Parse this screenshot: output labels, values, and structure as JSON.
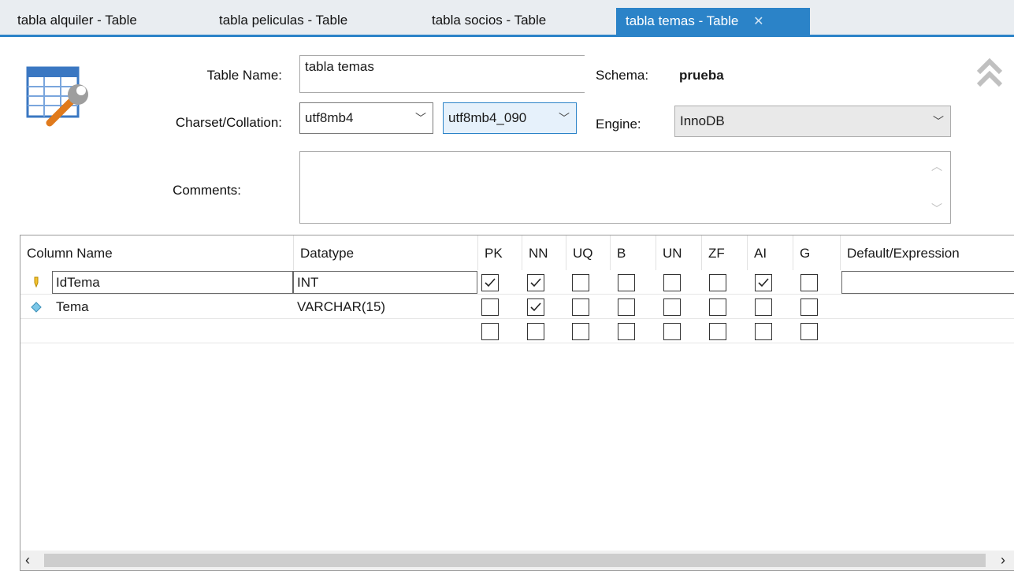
{
  "tabs": [
    {
      "label": "tabla alquiler - Table",
      "active": false
    },
    {
      "label": "tabla peliculas - Table",
      "active": false
    },
    {
      "label": "tabla socios - Table",
      "active": false
    },
    {
      "label": "tabla temas - Table",
      "active": true
    }
  ],
  "form": {
    "table_name_label": "Table Name:",
    "table_name_value": "tabla temas",
    "schema_label": "Schema:",
    "schema_value": "prueba",
    "charset_label": "Charset/Collation:",
    "charset_value": "utf8mb4",
    "collation_value": "utf8mb4_090",
    "engine_label": "Engine:",
    "engine_value": "InnoDB",
    "comments_label": "Comments:",
    "comments_value": ""
  },
  "grid": {
    "headers": [
      "Column Name",
      "Datatype",
      "PK",
      "NN",
      "UQ",
      "B",
      "UN",
      "ZF",
      "AI",
      "G",
      "Default/Expression"
    ],
    "rows": [
      {
        "name": "IdTema",
        "datatype": "INT",
        "icon": "primary-key-icon",
        "flags": [
          true,
          true,
          false,
          false,
          false,
          false,
          true,
          false
        ],
        "default": ""
      },
      {
        "name": "Tema",
        "datatype": "VARCHAR(15)",
        "icon": "column-diamond-icon",
        "flags": [
          false,
          true,
          false,
          false,
          false,
          false,
          false,
          false
        ],
        "default": ""
      },
      {
        "name": "",
        "datatype": "",
        "icon": "",
        "flags": [
          false,
          false,
          false,
          false,
          false,
          false,
          false,
          false
        ],
        "default": ""
      }
    ]
  },
  "colors": {
    "accent": "#2b83c8",
    "tabbar": "#e9edf1"
  }
}
